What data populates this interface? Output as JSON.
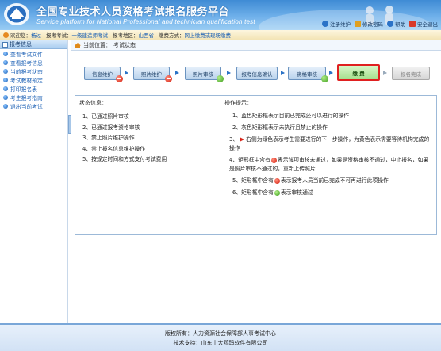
{
  "header": {
    "title": "全国专业技术人员资格考试报名服务平台",
    "subtitle": "Service platform for National Professional and technician qualification test",
    "links": [
      {
        "label": "注册维护",
        "icon": "register-icon",
        "color": "#2b73c7"
      },
      {
        "label": "修改密码",
        "icon": "lock-icon",
        "color": "#e0a020"
      },
      {
        "label": "帮助",
        "icon": "help-icon",
        "color": "#2b73c7"
      },
      {
        "label": "安全退出",
        "icon": "exit-icon",
        "color": "#d83a2a"
      }
    ]
  },
  "infobar": {
    "welcome_label": "欢迎您：",
    "user": "杨过",
    "exam_label": "报考考试：",
    "exam": "一级建造师考试",
    "region_label": "报考地区：",
    "region": "山西省",
    "pay_label": "缴费方式：",
    "pay": "网上缴费或现场缴费"
  },
  "sidebar": {
    "title": "报考信息",
    "items": [
      {
        "label": "查看考试文件"
      },
      {
        "label": "查看报考信息"
      },
      {
        "label": "当前报考状态"
      },
      {
        "label": "考试教材预定"
      },
      {
        "label": "打印报名表"
      },
      {
        "label": "考生报考指南"
      },
      {
        "label": "退出当前考试"
      }
    ]
  },
  "breadcrumb": {
    "label": "当前位置：",
    "page": "考试状态"
  },
  "steps": [
    {
      "label": "信息维护",
      "badge": "red"
    },
    {
      "label": "照片维护",
      "badge": "red"
    },
    {
      "label": "照片审核",
      "badge": "green"
    },
    {
      "label": "报考信息确认",
      "badge": ""
    },
    {
      "label": "资格审核",
      "badge": "green"
    },
    {
      "label": "缴 费",
      "badge": ""
    },
    {
      "label": "报名完成",
      "badge": ""
    }
  ],
  "status_panel": {
    "title": "状态信息：",
    "items": [
      "1、已通过照片审核",
      "2、已通过报考资格审核",
      "3、禁止照片维护操作",
      "4、禁止报名信息维护操作",
      "5、按规定时间和方式支付考试费用"
    ]
  },
  "tips_panel": {
    "title": "操作提示：",
    "tip1": "1、蓝色矩形框表示目前已完成还可以进行的操作",
    "tip2": "2、灰色矩形框表示未执行且禁止的操作",
    "tip3_a": "3、",
    "tip3_b": "右侧为绿色表示考生需要进行的下一步操作，为黄色表示需要等待机构完成的操作",
    "tip4_a": "4、矩形框中含有",
    "tip4_b": "表示该项审核未通过，如果是资格审核不通过，中止报名，如果是照片审核不通过的，重新上传照片",
    "tip5_a": "5、矩形框中含有",
    "tip5_b": "表示报考人员当前已完成不可再进行此项操作",
    "tip6_a": "6、矩形框中含有",
    "tip6_b": "表示审核通过"
  },
  "footer": {
    "line1": "版权所有：人力资源社会保障部人事考试中心",
    "line2": "技术支持：山东山大鸥玛软件有限公司"
  }
}
